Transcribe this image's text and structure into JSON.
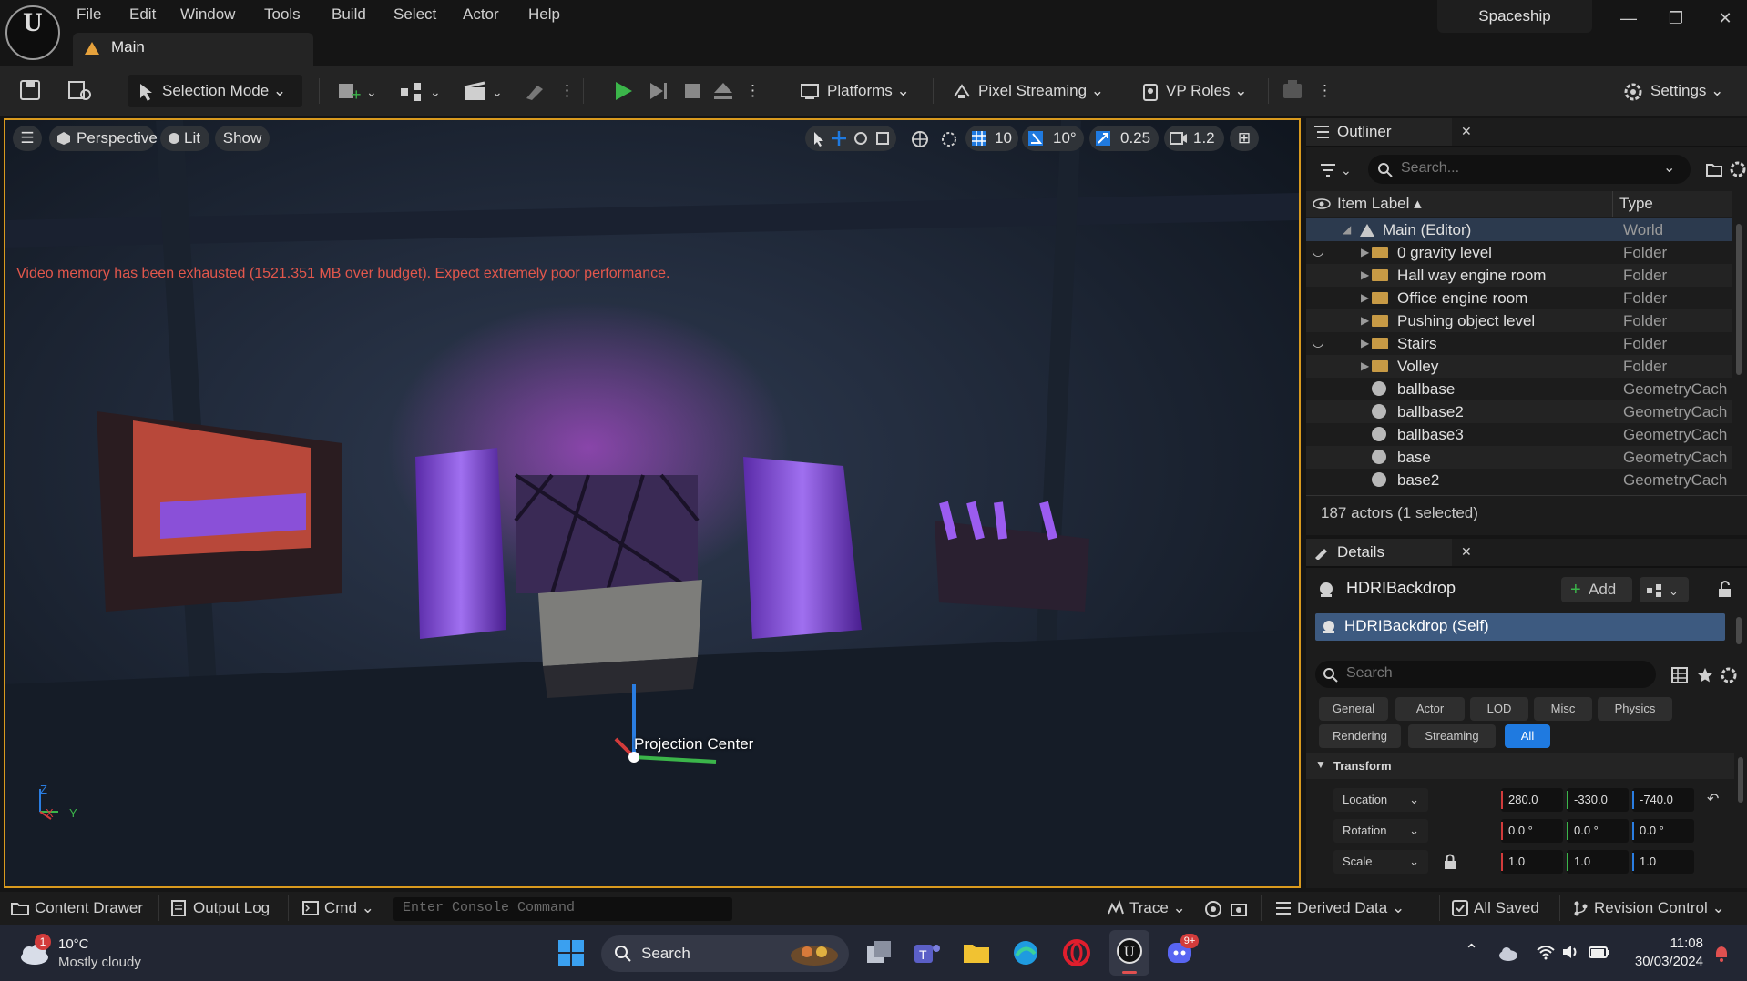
{
  "app": {
    "project_name": "Spaceship",
    "tab_label": "Main",
    "logo_letter": "U"
  },
  "menu": [
    "File",
    "Edit",
    "Window",
    "Tools",
    "Build",
    "Select",
    "Actor",
    "Help"
  ],
  "toolbar": {
    "selection_mode": "Selection Mode",
    "platforms": "Platforms",
    "pixel_streaming": "Pixel Streaming",
    "vp_roles": "VP Roles",
    "settings": "Settings"
  },
  "viewport": {
    "perspective": "Perspective",
    "lit": "Lit",
    "show": "Show",
    "grid_snap": "10",
    "rotation_snap": "10°",
    "scale_snap": "0.25",
    "camera_speed": "1.2",
    "warning": "Video memory has been exhausted (1521.351 MB over budget). Expect extremely poor performance.",
    "projection_label": "Projection Center",
    "axis_z": "Z",
    "axis_x": "X",
    "axis_y": "Y"
  },
  "outliner": {
    "title": "Outliner",
    "search_placeholder": "Search...",
    "col_label": "Item Label",
    "col_type": "Type",
    "rows": [
      {
        "label": "Main (Editor)",
        "type": "World",
        "kind": "world"
      },
      {
        "label": "0 gravity level",
        "type": "Folder",
        "kind": "folder"
      },
      {
        "label": "Hall way engine room",
        "type": "Folder",
        "kind": "folder"
      },
      {
        "label": "Office engine room",
        "type": "Folder",
        "kind": "folder"
      },
      {
        "label": "Pushing object level",
        "type": "Folder",
        "kind": "folder"
      },
      {
        "label": "Stairs",
        "type": "Folder",
        "kind": "folder"
      },
      {
        "label": "Volley",
        "type": "Folder",
        "kind": "folder"
      },
      {
        "label": "ballbase",
        "type": "GeometryCach",
        "kind": "geo"
      },
      {
        "label": "ballbase2",
        "type": "GeometryCach",
        "kind": "geo"
      },
      {
        "label": "ballbase3",
        "type": "GeometryCach",
        "kind": "geo"
      },
      {
        "label": "base",
        "type": "GeometryCach",
        "kind": "geo"
      },
      {
        "label": "base2",
        "type": "GeometryCach",
        "kind": "geo"
      }
    ],
    "actor_count": "187 actors (1 selected)"
  },
  "details": {
    "title": "Details",
    "actor_name": "HDRIBackdrop",
    "add_label": "Add",
    "component_self": "HDRIBackdrop (Self)",
    "search_placeholder": "Search",
    "categories_row1": [
      "General",
      "Actor",
      "LOD",
      "Misc",
      "Physics"
    ],
    "categories_row2": [
      "Rendering",
      "Streaming",
      "All"
    ],
    "section": "Transform",
    "location": {
      "label": "Location",
      "x": "280.0",
      "y": "-330.0",
      "z": "-740.0"
    },
    "rotation": {
      "label": "Rotation",
      "x": "0.0 °",
      "y": "0.0 °",
      "z": "0.0 °"
    },
    "scale": {
      "label": "Scale",
      "x": "1.0",
      "y": "1.0",
      "z": "1.0"
    }
  },
  "statusbar": {
    "content_drawer": "Content Drawer",
    "output_log": "Output Log",
    "cmd": "Cmd",
    "console_placeholder": "Enter Console Command",
    "trace": "Trace",
    "derived_data": "Derived Data",
    "all_saved": "All Saved",
    "revision_control": "Revision Control"
  },
  "taskbar": {
    "weather_temp": "10°C",
    "weather_desc": "Mostly cloudy",
    "weather_badge": "1",
    "search": "Search",
    "discord_badge": "9+",
    "time": "11:08",
    "date": "30/03/2024"
  },
  "colors": {
    "accent": "#1f7ae0",
    "play_green": "#3bb54a",
    "warning_red": "#e2574c",
    "viewport_border": "#d99a1e",
    "selected_row": "#3d5a80"
  }
}
